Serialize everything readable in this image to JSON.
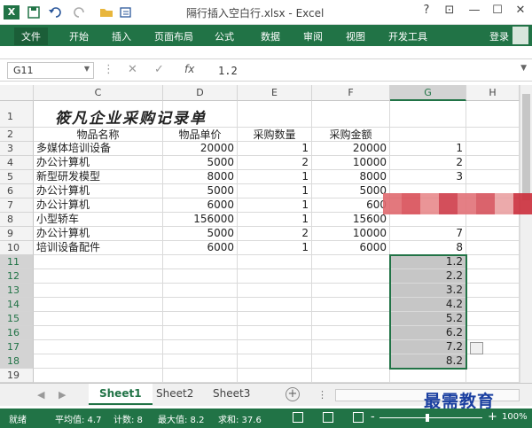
{
  "titlebar": {
    "title": "隔行插入空白行.xlsx - Excel",
    "app_icon": "X",
    "help": "?",
    "restore_ribbon": "⊡",
    "minimize": "—",
    "maximize": "☐",
    "close": "✕"
  },
  "quick_access": {
    "save_icon": "save-icon",
    "undo_icon": "undo-icon",
    "redo_icon": "redo-icon",
    "open_icon": "folder-icon"
  },
  "ribbon": {
    "tabs": [
      "文件",
      "开始",
      "插入",
      "页面布局",
      "公式",
      "数据",
      "审阅",
      "视图",
      "开发工具"
    ],
    "login": "登录"
  },
  "formula_bar": {
    "name_box": "G11",
    "fx": "fx",
    "value": "1.2"
  },
  "columns": [
    "C",
    "D",
    "E",
    "F",
    "G",
    "H"
  ],
  "rows": [
    "1",
    "2",
    "3",
    "4",
    "5",
    "6",
    "7",
    "8",
    "9",
    "10",
    "11",
    "12",
    "13",
    "14",
    "15",
    "16",
    "17",
    "18",
    "19"
  ],
  "sheet": {
    "title": "筱凡企业采购记录单",
    "headers": {
      "name": "物品名称",
      "price": "物品单价",
      "qty": "采购数量",
      "amount": "采购金额"
    },
    "data": [
      {
        "name": "多媒体培训设备",
        "price": "20000",
        "qty": "1",
        "amount": "20000",
        "g": "1"
      },
      {
        "name": "办公计算机",
        "price": "5000",
        "qty": "2",
        "amount": "10000",
        "g": "2"
      },
      {
        "name": "新型研发模型",
        "price": "8000",
        "qty": "1",
        "amount": "8000",
        "g": "3"
      },
      {
        "name": "办公计算机",
        "price": "5000",
        "qty": "1",
        "amount": "5000",
        "g": ""
      },
      {
        "name": "办公计算机",
        "price": "6000",
        "qty": "1",
        "amount": "600",
        "g": ""
      },
      {
        "name": "小型轿车",
        "price": "156000",
        "qty": "1",
        "amount": "15600",
        "g": ""
      },
      {
        "name": "办公计算机",
        "price": "5000",
        "qty": "2",
        "amount": "10000",
        "g": "7"
      },
      {
        "name": "培训设备配件",
        "price": "6000",
        "qty": "1",
        "amount": "6000",
        "g": "8"
      }
    ],
    "g_values": [
      "1.2",
      "2.2",
      "3.2",
      "4.2",
      "5.2",
      "6.2",
      "7.2",
      "8.2"
    ]
  },
  "sheet_tabs": [
    "Sheet1",
    "Sheet2",
    "Sheet3"
  ],
  "add_sheet": "+",
  "watermark": "最需教育",
  "status": {
    "ready": "就绪",
    "average": "平均值: 4.7",
    "count": "计数: 8",
    "max": "最大值: 8.2",
    "sum": "求和: 37.6",
    "zoom": "100%",
    "minus": "-",
    "plus": "+"
  },
  "colors": {
    "accent": "#217346",
    "selection": "#c6c6c6"
  }
}
